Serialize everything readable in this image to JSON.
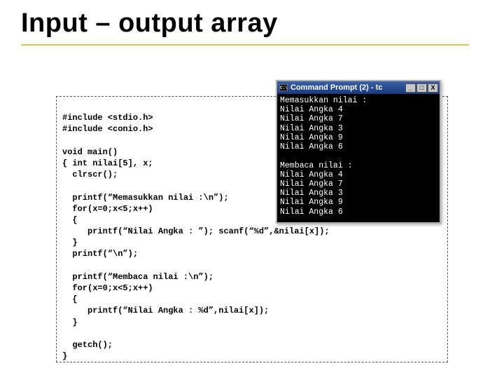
{
  "heading": "Input – output array",
  "code": {
    "l1": "#include <stdio.h>",
    "l2": "#include <conio.h>",
    "l3": "",
    "l4": "void main()",
    "l5": "{ int nilai[5], x;",
    "l6": "  clrscr();",
    "l7": "",
    "l8": "  printf(“Memasukkan nilai :\\n”);",
    "l9": "  for(x=0;x<5;x++)",
    "l10": "  {",
    "l11": "     printf(“Nilai Angka : ”); scanf(“%d”,&nilai[x]);",
    "l12": "  }",
    "l13": "  printf(“\\n”);",
    "l14": "",
    "l15": "  printf(“Membaca nilai :\\n”);",
    "l16": "  for(x=0;x<5;x++)",
    "l17": "  {",
    "l18": "     printf(“Nilai Angka : %d”,nilai[x]);",
    "l19": "  }",
    "l20": "",
    "l21": "  getch();",
    "l22": "}"
  },
  "cmd": {
    "title": "Command Prompt (2) - tc",
    "icon_name": "console-icon",
    "min_label": "_",
    "max_label": "□",
    "close_label": "X",
    "body": "Memasukkan nilai :\nNilai Angka 4\nNilai Angka 7\nNilai Angka 3\nNilai Angka 9\nNilai Angka 6\n\nMembaca nilai :\nNilai Angka 4\nNilai Angka 7\nNilai Angka 3\nNilai Angka 9\nNilai Angka 6"
  }
}
